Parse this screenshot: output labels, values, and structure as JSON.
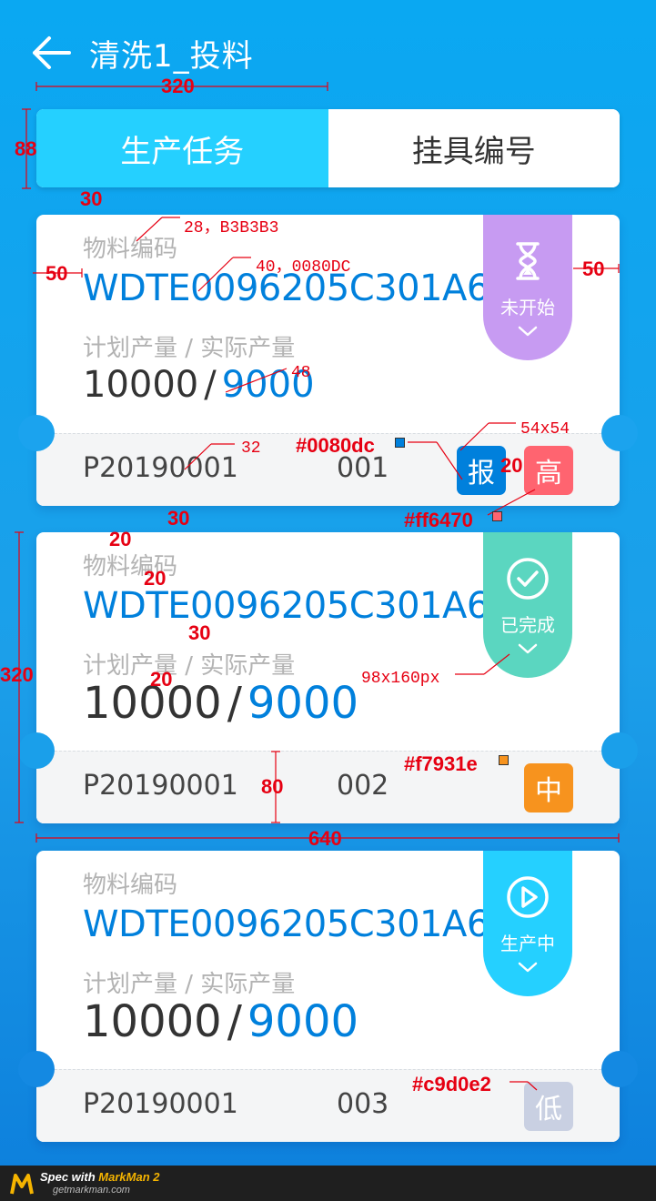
{
  "header": {
    "title": "清洗1_投料",
    "back_icon": "arrow-left-icon"
  },
  "tabs": [
    {
      "label": "生产任务",
      "active": true
    },
    {
      "label": "挂具编号",
      "active": false
    }
  ],
  "cards": [
    {
      "code_label": "物料编码",
      "code": "WDTE0096205C301A6",
      "qty_label": "计划产量 / 实际产量",
      "planned": "10000",
      "slash": "/",
      "actual": "9000",
      "order_no": "P20190001",
      "seq": "001",
      "status": {
        "label": "未开始",
        "icon": "hourglass-icon",
        "color": "#c79bf2"
      },
      "badges": [
        {
          "text": "报",
          "color": "#0080dc"
        },
        {
          "text": "高",
          "color": "#ff6470"
        }
      ]
    },
    {
      "code_label": "物料编码",
      "code": "WDTE0096205C301A6",
      "qty_label": "计划产量 / 实际产量",
      "planned": "10000",
      "slash": "/",
      "actual": "9000",
      "order_no": "P20190001",
      "seq": "002",
      "status": {
        "label": "已完成",
        "icon": "check-circle-icon",
        "color": "#5bd6c0"
      },
      "badges": [
        {
          "text": "中",
          "color": "#f7931e"
        }
      ]
    },
    {
      "code_label": "物料编码",
      "code": "WDTE0096205C301A6",
      "qty_label": "计划产量 / 实际产量",
      "planned": "10000",
      "slash": "/",
      "actual": "9000",
      "order_no": "P20190001",
      "seq": "003",
      "status": {
        "label": "生产中",
        "icon": "play-circle-icon",
        "color": "#25d0ff"
      },
      "badges": [
        {
          "text": "低",
          "color": "#c9d0e2"
        }
      ]
    }
  ],
  "annotations": {
    "w320": "320",
    "h88": "88",
    "gap30a": "30",
    "label_spec": "28，B3B3B3",
    "code_spec": "40，0080DC",
    "margin50_left": "50",
    "margin50_right": "50",
    "qty48": "48",
    "order32": "32",
    "badge_size": "54x54",
    "color_blue": "#0080dc",
    "gap20_badges": "20",
    "color_red": "#ff6470",
    "gap30b": "30",
    "gap20a": "20",
    "gap20b": "20",
    "gap30c": "30",
    "gap20c": "20",
    "h320": "320",
    "status_size": "98x160px",
    "color_orange": "#f7931e",
    "h80": "80",
    "w640": "640",
    "color_grey": "#c9d0e2"
  },
  "footer": {
    "spec_prefix": "Spec with ",
    "brand": "MarkMan 2",
    "site": "getmarkman.com"
  }
}
